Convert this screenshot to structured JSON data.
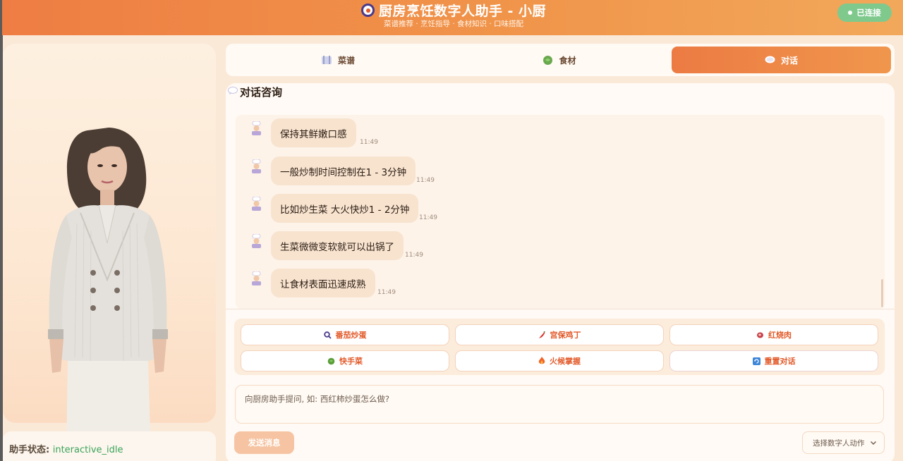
{
  "header": {
    "title": "厨房烹饪数字人助手 - 小厨",
    "subtitle": "菜谱推荐 · 烹饪指导 · 食材知识 · 口味搭配",
    "connection_status": "已连接"
  },
  "left": {
    "status_label": "助手状态:",
    "status_value": "interactive_idle"
  },
  "tabs": [
    {
      "label": "菜谱",
      "icon": "recipe-icon",
      "active": false
    },
    {
      "label": "食材",
      "icon": "ingredient-icon",
      "active": false
    },
    {
      "label": "对话",
      "icon": "chat-icon",
      "active": true
    }
  ],
  "chat": {
    "title": "对话咨询",
    "messages": [
      {
        "text": "保持其鲜嫩口感",
        "time": "11:49"
      },
      {
        "text": "一般炒制时间控制在1 - 3分钟",
        "time": "11:49"
      },
      {
        "text": "比如炒生菜 大火快炒1 - 2分钟",
        "time": "11:49"
      },
      {
        "text": "生菜微微变软就可以出锅了",
        "time": "11:49"
      },
      {
        "text": "让食材表面迅速成熟",
        "time": "11:49"
      }
    ]
  },
  "quick_actions": [
    {
      "label": "番茄炒蛋",
      "icon": "search-icon"
    },
    {
      "label": "宫保鸡丁",
      "icon": "chili-icon"
    },
    {
      "label": "红烧肉",
      "icon": "meat-icon"
    },
    {
      "label": "快手菜",
      "icon": "vegetable-icon"
    },
    {
      "label": "火候掌握",
      "icon": "fire-icon"
    },
    {
      "label": "重置对话",
      "icon": "refresh-icon"
    }
  ],
  "input": {
    "placeholder": "向厨房助手提问, 如: 西红柿炒蛋怎么做?",
    "value": ""
  },
  "send_label": "发送消息",
  "action_select": {
    "selected": "选择数字人动作"
  },
  "colors": {
    "accent": "#ee7d43",
    "connected": "#7fc98d",
    "bubble": "#f8e3cf",
    "status_value": "#3aa35a"
  }
}
